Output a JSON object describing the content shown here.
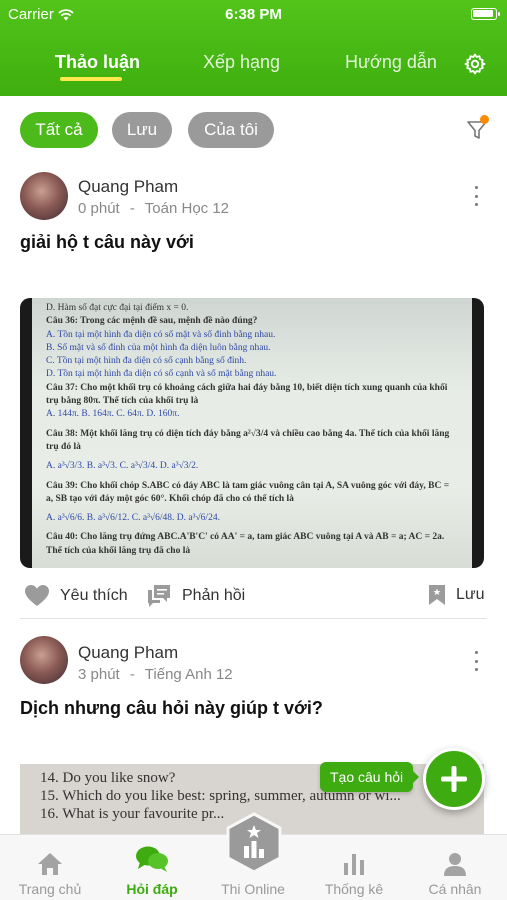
{
  "status_bar": {
    "carrier": "Carrier",
    "time": "6:38 PM"
  },
  "header": {
    "tabs": [
      {
        "label": "Thảo luận",
        "active": true
      },
      {
        "label": "Xếp hạng",
        "active": false
      },
      {
        "label": "Hướng dẫn",
        "active": false
      }
    ],
    "settings_icon": "gear-icon"
  },
  "filters": {
    "chips": [
      {
        "label": "Tất cả",
        "active": true
      },
      {
        "label": "Lưu",
        "active": false
      },
      {
        "label": "Của tôi",
        "active": false
      }
    ],
    "filter_icon": "funnel-icon",
    "indicator_color": "#ff8a00"
  },
  "posts": [
    {
      "author": "Quang Pham",
      "time": "0 phút",
      "separator": "-",
      "subject": "Toán Học 12",
      "title": "giải hộ t câu này với",
      "photo_text": [
        "D. Hàm số đạt cực đại tại điểm x = 0.",
        "Câu 36: Trong các mệnh đề sau, mệnh đề nào đúng?",
        "A. Tồn tại một hình đa diện có số mặt và số đỉnh bằng nhau.",
        "B. Số mặt và số đỉnh của một hình đa diện luôn bằng nhau.",
        "C. Tồn tại một hình đa diện có số cạnh bằng số đỉnh.",
        "D. Tồn tại một hình đa diện có số cạnh và số mặt bằng nhau.",
        "Câu 37: Cho một khối trụ có khoảng cách giữa hai đáy bằng 10, biết diện tích xung quanh của khối trụ bằng 80π. Thể tích của khối trụ là",
        "A. 144π.      B. 164π.      C. 64π.      D. 160π.",
        "Câu 38: Một khối lăng trụ có diện tích đáy bằng a²√3/4 và chiều cao bằng 4a. Thể tích của khối lăng trụ đó là",
        "A. a³√3/3.      B. a³√3.      C. a³√3/4.      D. a³√3/2.",
        "Câu 39: Cho khối chóp S.ABC có đáy ABC là tam giác vuông cân tại A, SA vuông góc với đáy, BC = a, SB tạo với đáy một góc 60°. Khối chóp đã cho có thể tích là",
        "A. a³√6/6.      B. a³√6/12.      C. a³√6/48.      D. a³√6/24.",
        "Câu 40: Cho lăng trụ đứng ABC.A'B'C' có AA' = a, tam giác ABC vuông tại A và AB = a; AC = 2a. Thể tích của khối lăng trụ đã cho là"
      ],
      "actions": {
        "like": "Yêu thích",
        "reply": "Phản hồi",
        "save": "Lưu"
      }
    },
    {
      "author": "Quang Pham",
      "time": "3 phút",
      "separator": "-",
      "subject": "Tiếng Anh 12",
      "title": "Dịch nhưng câu hỏi này giúp t với?",
      "photo_text": [
        "14. Do you like snow?",
        "15. Which do you like best: spring, summer, autumn or wi...",
        "16. What is your favourite pr..."
      ]
    }
  ],
  "fab": {
    "label": "Tạo câu hỏi",
    "icon": "plus-icon"
  },
  "bottom_nav": [
    {
      "label": "Trang chủ",
      "icon": "home-icon",
      "active": false
    },
    {
      "label": "Hỏi đáp",
      "icon": "chat-bubbles-icon",
      "active": true
    },
    {
      "label": "Thi Online",
      "icon": "exam-hexagon-icon",
      "active": false
    },
    {
      "label": "Thống kê",
      "icon": "bar-chart-icon",
      "active": false
    },
    {
      "label": "Cá nhân",
      "icon": "person-icon",
      "active": false
    }
  ],
  "colors": {
    "brand_green": "#4cba1a",
    "active_tab_underline": "#ffe84d"
  }
}
